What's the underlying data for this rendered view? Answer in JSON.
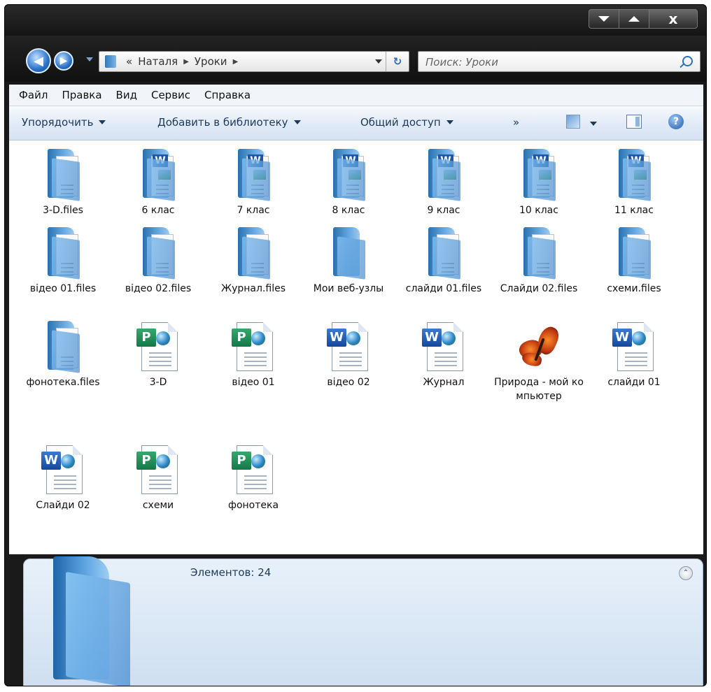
{
  "window": {
    "caption_buttons": [
      "chevron-down-icon",
      "chevron-up-icon",
      "close-icon"
    ],
    "close_glyph": "x"
  },
  "nav": {
    "breadcrumb_prefix": "«",
    "crumbs": [
      "Наталя",
      "Уроки"
    ],
    "search_placeholder": "Поиск: Уроки"
  },
  "menu": [
    "Файл",
    "Правка",
    "Вид",
    "Сервис",
    "Справка"
  ],
  "toolbar": {
    "organize": "Упорядочить",
    "add_library": "Добавить в библиотеку",
    "share": "Общий доступ",
    "more": "»",
    "help": "?"
  },
  "files": [
    {
      "name": "3-D.files",
      "kind": "folder-doc"
    },
    {
      "name": "6 клас",
      "kind": "folder-word"
    },
    {
      "name": "7 клас",
      "kind": "folder-word"
    },
    {
      "name": "8 клас",
      "kind": "folder-word"
    },
    {
      "name": "9 клас",
      "kind": "folder-word"
    },
    {
      "name": "10 клас",
      "kind": "folder-word"
    },
    {
      "name": "11 клас",
      "kind": "folder-word"
    },
    {
      "name": "відео 01.files",
      "kind": "folder-doc"
    },
    {
      "name": "відео 02.files",
      "kind": "folder-doc"
    },
    {
      "name": "Журнал.files",
      "kind": "folder-doc"
    },
    {
      "name": "Мои веб-узлы",
      "kind": "folder"
    },
    {
      "name": "слайди 01.files",
      "kind": "folder-doc"
    },
    {
      "name": "Слайди 02.files",
      "kind": "folder-doc"
    },
    {
      "name": "схеми.files",
      "kind": "folder-doc"
    },
    {
      "name": "фонотека.files",
      "kind": "folder-doc"
    },
    {
      "name": "3-D",
      "kind": "publisher"
    },
    {
      "name": "відео 01",
      "kind": "publisher"
    },
    {
      "name": "відео 02",
      "kind": "word"
    },
    {
      "name": "Журнал",
      "kind": "word"
    },
    {
      "name": "Природа - мой компьютер",
      "kind": "image"
    },
    {
      "name": "слайди 01",
      "kind": "word"
    },
    {
      "name": "Слайди 02",
      "kind": "word"
    },
    {
      "name": "схеми",
      "kind": "publisher"
    },
    {
      "name": "фонотека",
      "kind": "publisher"
    }
  ],
  "details": {
    "count_text": "Элементов: 24"
  },
  "colors": {
    "accent": "#1e395b",
    "frame": "#1a1a1a",
    "details_bg": "#dce8f5"
  }
}
